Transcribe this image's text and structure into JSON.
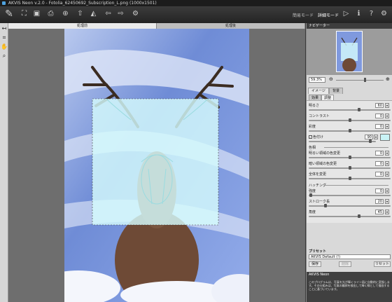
{
  "window": {
    "title": "AKVIS Neon v.2.0 - Fotolia_62450692_Subscription_L.png (1000x1501)"
  },
  "toolbar": {
    "icons": [
      "paintbrush-icon",
      "open-icon",
      "save-icon",
      "print-icon",
      "share-icon",
      "upload-icon",
      "batch-icon",
      "back-icon",
      "forward-icon",
      "settings-icon"
    ],
    "mode_express": "簡易モード",
    "mode_advanced": "詳細モード",
    "run_icon": "play-icon",
    "info_icon": "info-icon",
    "help_icon": "help-icon",
    "prefs_icon": "gear-icon"
  },
  "tools": [
    "crop-icon",
    "hand-icon",
    "zoom-icon"
  ],
  "tabs": {
    "before": "処理前",
    "after": "処理後"
  },
  "navigator": {
    "title": "ナビゲーター",
    "zoom": "59.3%"
  },
  "panel_tabs": {
    "image": "イメージ",
    "background": "背景"
  },
  "sub_tabs": {
    "effect": "効果",
    "adjust": "調整"
  },
  "params": {
    "brightness": {
      "label": "明るさ",
      "value": "60",
      "level": 0.6
    },
    "contrast": {
      "label": "コントラスト",
      "value": "0",
      "level": 0.5
    },
    "saturation": {
      "label": "彩度",
      "value": "0",
      "level": 0.5
    },
    "tint": {
      "label": "色付け",
      "value": "90",
      "level": 0.9,
      "checked": true,
      "color": "#c9f3f6"
    },
    "color_section": "色相",
    "light_hue": {
      "label": "明るい領域の色変更",
      "value": "0",
      "level": 0.5
    },
    "dark_hue": {
      "label": "暗い領域の色変更",
      "value": "0",
      "level": 0.5
    },
    "global_hue": {
      "label": "全体を変更",
      "value": "0",
      "level": 0.5
    },
    "hatch_section": "ハッチング",
    "strength": {
      "label": "強度",
      "value": "0",
      "level": 0.02
    },
    "stroke": {
      "label": "ストローク長",
      "value": "20",
      "level": 0.2
    },
    "angle": {
      "label": "角度",
      "value": "45",
      "level": 0.6
    }
  },
  "presets": {
    "title": "プリセット",
    "selected": "AKVIS Default (!)",
    "save": "保存",
    "delete": "削除",
    "reset": "リセット"
  },
  "help": {
    "title": "AKVIS Neon",
    "body": "このプログラムは、写真を光が輝くライン画に自動的に変換します。その仕組みは、写真の輪郭を検出して輝く線として描画することに基づいています。"
  },
  "colors": {
    "accent": "#c9f3f6",
    "toolbar": "#2b2b2b",
    "panel": "#d9d9d9"
  }
}
